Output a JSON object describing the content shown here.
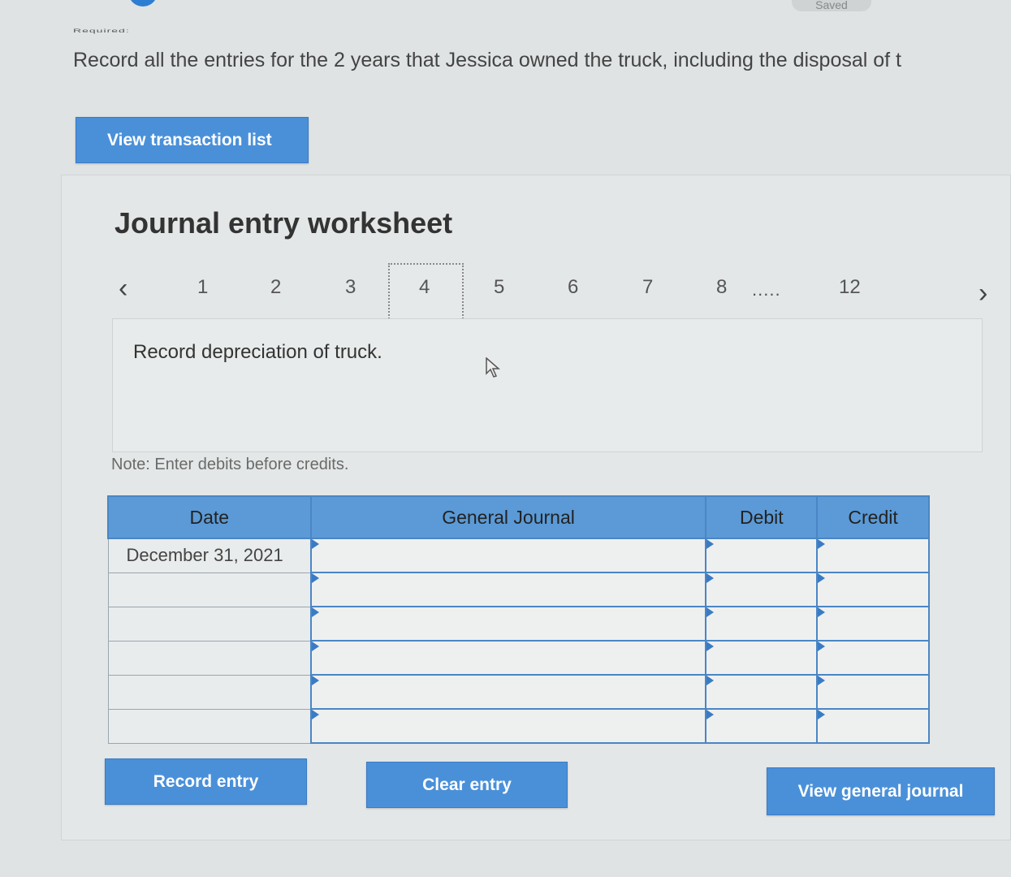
{
  "header": {
    "saved_label": "Saved",
    "required_label": "Required:",
    "instruction": "Record all the entries for the 2 years that Jessica owned the truck, including the disposal of t"
  },
  "buttons": {
    "view_transaction_list": "View transaction list",
    "record_entry": "Record entry",
    "clear_entry": "Clear entry",
    "view_general_journal": "View general journal"
  },
  "worksheet": {
    "title": "Journal entry worksheet",
    "pages": [
      "1",
      "2",
      "3",
      "4",
      "5",
      "6",
      "7",
      "8",
      "12"
    ],
    "ellipsis": ".....",
    "active_page": "4",
    "prev_icon": "‹",
    "next_icon": "›",
    "description": "Record depreciation of truck.",
    "note": "Note: Enter debits before credits."
  },
  "table": {
    "headers": {
      "date": "Date",
      "general_journal": "General Journal",
      "debit": "Debit",
      "credit": "Credit"
    },
    "rows": [
      {
        "date": "December 31, 2021",
        "account": "",
        "debit": "",
        "credit": ""
      },
      {
        "date": "",
        "account": "",
        "debit": "",
        "credit": ""
      },
      {
        "date": "",
        "account": "",
        "debit": "",
        "credit": ""
      },
      {
        "date": "",
        "account": "",
        "debit": "",
        "credit": ""
      },
      {
        "date": "",
        "account": "",
        "debit": "",
        "credit": ""
      },
      {
        "date": "",
        "account": "",
        "debit": "",
        "credit": ""
      }
    ]
  },
  "colors": {
    "button_blue": "#4a90d9",
    "header_blue": "#5b9ad6",
    "background": "#dfe3e4"
  }
}
